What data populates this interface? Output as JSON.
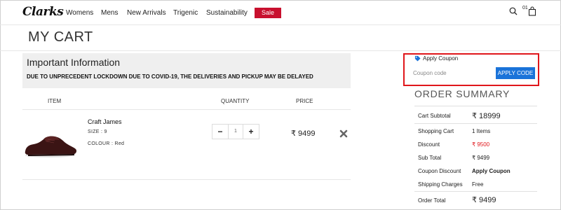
{
  "header": {
    "logo": "Clarks",
    "nav": [
      "Womens",
      "Mens",
      "New Arrivals",
      "Trigenic",
      "Sustainability"
    ],
    "sale_label": "Sale",
    "cart_count": "01",
    "sale_color": "#c8102e"
  },
  "page": {
    "title": "MY CART"
  },
  "info": {
    "title": "Important Information",
    "text": "DUE TO UNPRECEDENT LOCKDOWN DUE TO COVID-19, THE DELIVERIES AND PICKUP MAY BE DELAYED"
  },
  "table": {
    "headers": [
      "ITEM",
      "QUANTITY",
      "PRICE"
    ],
    "items": [
      {
        "name": "Craft James",
        "size": "SIZE : 9",
        "colour": "COLOUR : Red",
        "quantity": "1",
        "minus": "−",
        "plus": "+",
        "price": "₹ 9499"
      }
    ]
  },
  "coupon": {
    "label": "Apply Coupon",
    "placeholder": "Coupon code",
    "button": "APPLY CODE",
    "highlight_color": "#e0161b",
    "button_color": "#1a73d9"
  },
  "summary": {
    "title": "ORDER SUMMARY",
    "rows": [
      {
        "label": "Cart Subtotal",
        "value": "₹ 18999"
      },
      {
        "label": "Shopping Cart",
        "value": "1 Items"
      },
      {
        "label": "Discount",
        "value": "₹ 9500"
      },
      {
        "label": "Sub Total",
        "value": "₹ 9499"
      },
      {
        "label": "Coupon Discount",
        "value": "Apply Coupon"
      },
      {
        "label": "Shipping Charges",
        "value": "Free"
      },
      {
        "label": "Order Total",
        "value": "₹ 9499"
      }
    ]
  },
  "icons": {
    "search": "search-icon",
    "bag": "shopping-bag-icon",
    "tag": "tag-icon",
    "remove": "close-icon",
    "product": "shoe-image"
  }
}
